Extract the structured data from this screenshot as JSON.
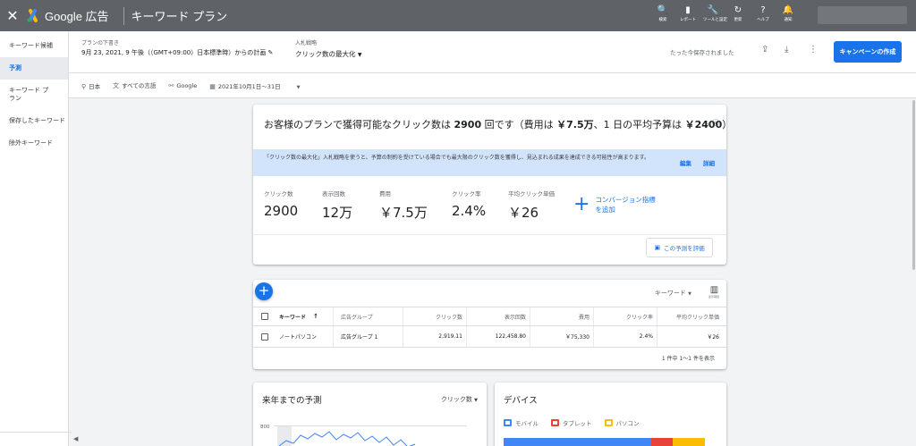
{
  "topbar": {
    "brand": "Google 広告",
    "page_title": "キーワード プラン",
    "tools": [
      {
        "icon": "search-icon",
        "glyph": "🔍",
        "label": "検索"
      },
      {
        "icon": "reports-icon",
        "glyph": "▮",
        "label": "レポート"
      },
      {
        "icon": "wrench-icon",
        "glyph": "🔧",
        "label": "ツールと設定"
      },
      {
        "icon": "refresh-icon",
        "glyph": "↻",
        "label": "更新"
      },
      {
        "icon": "help-icon",
        "glyph": "?",
        "label": "ヘルプ"
      },
      {
        "icon": "bell-icon",
        "glyph": "🔔",
        "label": "通知"
      }
    ]
  },
  "sidebar": {
    "items": [
      {
        "label": "キーワード候補"
      },
      {
        "label": "予測"
      },
      {
        "label": "キーワード プラン"
      },
      {
        "label": "保存したキーワード"
      },
      {
        "label": "除外キーワード"
      }
    ]
  },
  "plan": {
    "draft_label": "プランの下書き",
    "date_title": "9月 23, 2021, 9 午後（（GMT+09:00）日本標準時）からの計画",
    "bid_label": "入札戦略",
    "bid_value": "クリック数の最大化",
    "saved_text": "たった今保存されました",
    "campaign_button": "キャンペーンの作成"
  },
  "filters": {
    "location": "日本",
    "language": "すべての言語",
    "network": "Google",
    "date_range": "2021年10月1日～31日"
  },
  "forecast": {
    "headline_pre": "お客様のプランで獲得可能なクリック数は ",
    "headline_clicks": "2900",
    "headline_mid": " 回です（費用は ",
    "headline_cost": "￥7.5万",
    "headline_mid2": "、1 日の平均予算は ",
    "headline_budget": "￥2400",
    "headline_end": "）",
    "info_text": "「クリック数の最大化」入札戦略を使うと、予算の制約を受けている場合でも最大限のクリック数を獲得し、見込まれる成果を達成できる可能性が高まります。",
    "edit_link": "編集",
    "detail_link": "詳細",
    "metrics": [
      {
        "label": "クリック数",
        "value": "2900"
      },
      {
        "label": "表示回数",
        "value": "12万"
      },
      {
        "label": "費用",
        "value": "￥7.5万"
      },
      {
        "label": "クリック率",
        "value": "2.4%"
      },
      {
        "label": "平均クリック単価",
        "value": "￥26"
      }
    ],
    "conversion_line1": "コンバージョン指標",
    "conversion_line2": "を追加",
    "evaluate_button": "この予測を評価"
  },
  "keywords": {
    "dropdown": "キーワード",
    "columns_label": "表示項目",
    "headers": [
      "キーワード",
      "広告グループ",
      "クリック数",
      "表示回数",
      "費用",
      "クリック率",
      "平均クリック単価"
    ],
    "rows": [
      {
        "keyword": "ノートパソコン",
        "group": "広告グループ 1",
        "clicks": "2,919.11",
        "impressions": "122,458.80",
        "cost": "￥75,330",
        "ctr": "2.4%",
        "cpc": "￥26"
      }
    ],
    "pager": "1 件中 1～1 件を表示"
  },
  "yearly": {
    "title": "来年までの予測",
    "metric": "クリック数",
    "y_tick": "800"
  },
  "devices": {
    "title": "デバイス",
    "legend": [
      {
        "label": "モバイル",
        "color": "#4285f4"
      },
      {
        "label": "タブレット",
        "color": "#ea4335"
      },
      {
        "label": "パソコン",
        "color": "#fbbc04"
      }
    ],
    "shares": [
      0.69,
      0.1,
      0.15
    ]
  }
}
